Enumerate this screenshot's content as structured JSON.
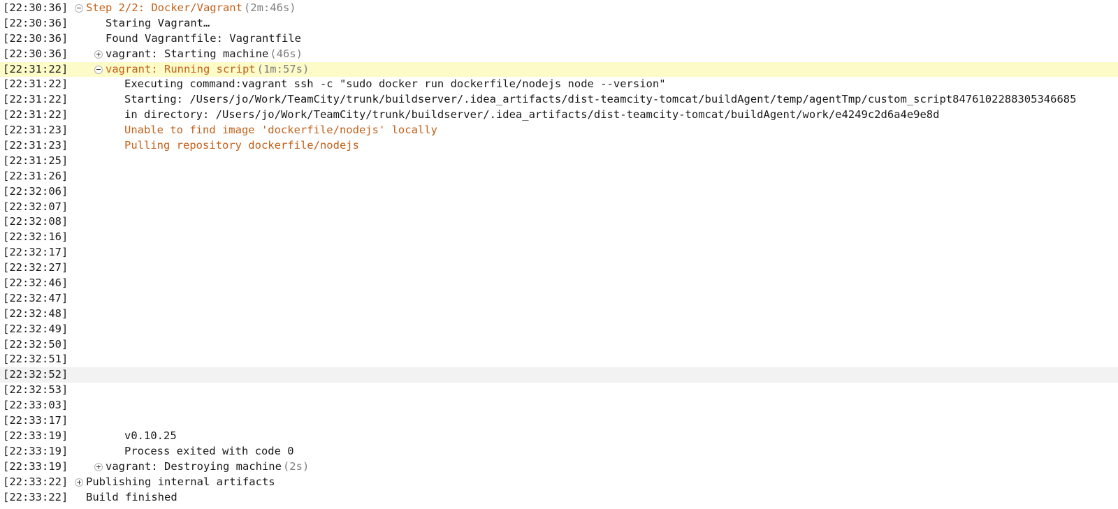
{
  "colors": {
    "warning_text": "#c3611a",
    "duration_text": "#808080",
    "highlight_selected": "#fdfbc8",
    "highlight_hover": "#f2f2f2"
  },
  "log": [
    {
      "ts": "[22:30:36]",
      "level": 0,
      "toggle": "minus",
      "text": "Step 2/2: Docker/Vagrant",
      "duration": "(2m:46s)",
      "style": "orange"
    },
    {
      "ts": "[22:30:36]",
      "level": 1,
      "toggle": null,
      "text": "Staring Vagrant…"
    },
    {
      "ts": "[22:30:36]",
      "level": 1,
      "toggle": null,
      "text": "Found Vagrantfile: Vagrantfile"
    },
    {
      "ts": "[22:30:36]",
      "level": 1,
      "toggle": "plus",
      "text": "vagrant: Starting machine",
      "duration": "(46s)"
    },
    {
      "ts": "[22:31:22]",
      "level": 1,
      "toggle": "minus",
      "text": "vagrant: Running script",
      "duration": "(1m:57s)",
      "style": "orange",
      "highlight": "yellow"
    },
    {
      "ts": "[22:31:22]",
      "level": 2,
      "toggle": null,
      "text": "Executing command:vagrant ssh -c \"sudo docker run dockerfile/nodejs node --version\""
    },
    {
      "ts": "[22:31:22]",
      "level": 2,
      "toggle": null,
      "text": "Starting: /Users/jo/Work/TeamCity/trunk/buildserver/.idea_artifacts/dist-teamcity-tomcat/buildAgent/temp/agentTmp/custom_script8476102288305346685"
    },
    {
      "ts": "[22:31:22]",
      "level": 2,
      "toggle": null,
      "text": "in directory: /Users/jo/Work/TeamCity/trunk/buildserver/.idea_artifacts/dist-teamcity-tomcat/buildAgent/work/e4249c2d6a4e9e8d"
    },
    {
      "ts": "[22:31:23]",
      "level": 2,
      "toggle": null,
      "text": "Unable to find image 'dockerfile/nodejs' locally",
      "style": "orange"
    },
    {
      "ts": "[22:31:23]",
      "level": 2,
      "toggle": null,
      "text": "Pulling repository dockerfile/nodejs",
      "style": "orange"
    },
    {
      "ts": "[22:31:25]",
      "level": 2,
      "toggle": null,
      "text": ""
    },
    {
      "ts": "[22:31:26]",
      "level": 2,
      "toggle": null,
      "text": ""
    },
    {
      "ts": "[22:32:06]",
      "level": 2,
      "toggle": null,
      "text": ""
    },
    {
      "ts": "[22:32:07]",
      "level": 2,
      "toggle": null,
      "text": ""
    },
    {
      "ts": "[22:32:08]",
      "level": 2,
      "toggle": null,
      "text": ""
    },
    {
      "ts": "[22:32:16]",
      "level": 2,
      "toggle": null,
      "text": ""
    },
    {
      "ts": "[22:32:17]",
      "level": 2,
      "toggle": null,
      "text": ""
    },
    {
      "ts": "[22:32:27]",
      "level": 2,
      "toggle": null,
      "text": ""
    },
    {
      "ts": "[22:32:46]",
      "level": 2,
      "toggle": null,
      "text": ""
    },
    {
      "ts": "[22:32:47]",
      "level": 2,
      "toggle": null,
      "text": ""
    },
    {
      "ts": "[22:32:48]",
      "level": 2,
      "toggle": null,
      "text": ""
    },
    {
      "ts": "[22:32:49]",
      "level": 2,
      "toggle": null,
      "text": ""
    },
    {
      "ts": "[22:32:50]",
      "level": 2,
      "toggle": null,
      "text": ""
    },
    {
      "ts": "[22:32:51]",
      "level": 2,
      "toggle": null,
      "text": ""
    },
    {
      "ts": "[22:32:52]",
      "level": 2,
      "toggle": null,
      "text": "",
      "highlight": "grey"
    },
    {
      "ts": "[22:32:53]",
      "level": 2,
      "toggle": null,
      "text": ""
    },
    {
      "ts": "[22:33:03]",
      "level": 2,
      "toggle": null,
      "text": ""
    },
    {
      "ts": "[22:33:17]",
      "level": 2,
      "toggle": null,
      "text": ""
    },
    {
      "ts": "[22:33:19]",
      "level": 2,
      "toggle": null,
      "text": "v0.10.25"
    },
    {
      "ts": "[22:33:19]",
      "level": 2,
      "toggle": null,
      "text": "Process exited with code 0"
    },
    {
      "ts": "[22:33:19]",
      "level": 1,
      "toggle": "plus",
      "text": "vagrant: Destroying machine",
      "duration": "(2s)"
    },
    {
      "ts": "[22:33:22]",
      "level": 0,
      "toggle": "plus",
      "text": "Publishing internal artifacts"
    },
    {
      "ts": "[22:33:22]",
      "level": 0,
      "toggle": null,
      "text": "Build finished"
    }
  ]
}
